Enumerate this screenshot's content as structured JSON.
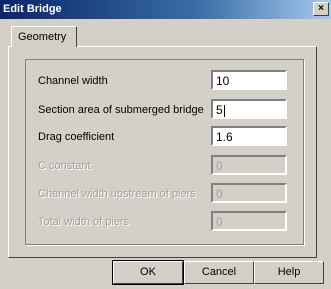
{
  "window": {
    "title": "Edit Bridge",
    "close_glyph": "×"
  },
  "tabs": [
    {
      "label": "Geometry"
    }
  ],
  "form": {
    "fields": [
      {
        "label": "Channel width",
        "value": "10",
        "enabled": true
      },
      {
        "label": "Section area of submerged bridge",
        "value": "5",
        "enabled": true
      },
      {
        "label": "Drag coefficient",
        "value": "1.6",
        "enabled": true
      },
      {
        "label": "C constant",
        "value": "0",
        "enabled": false
      },
      {
        "label": "Channel width upstream of piers",
        "value": "0",
        "enabled": false
      },
      {
        "label": "Total width of piers",
        "value": "0",
        "enabled": false
      }
    ]
  },
  "buttons": {
    "ok": "OK",
    "cancel": "Cancel",
    "help": "Help"
  }
}
